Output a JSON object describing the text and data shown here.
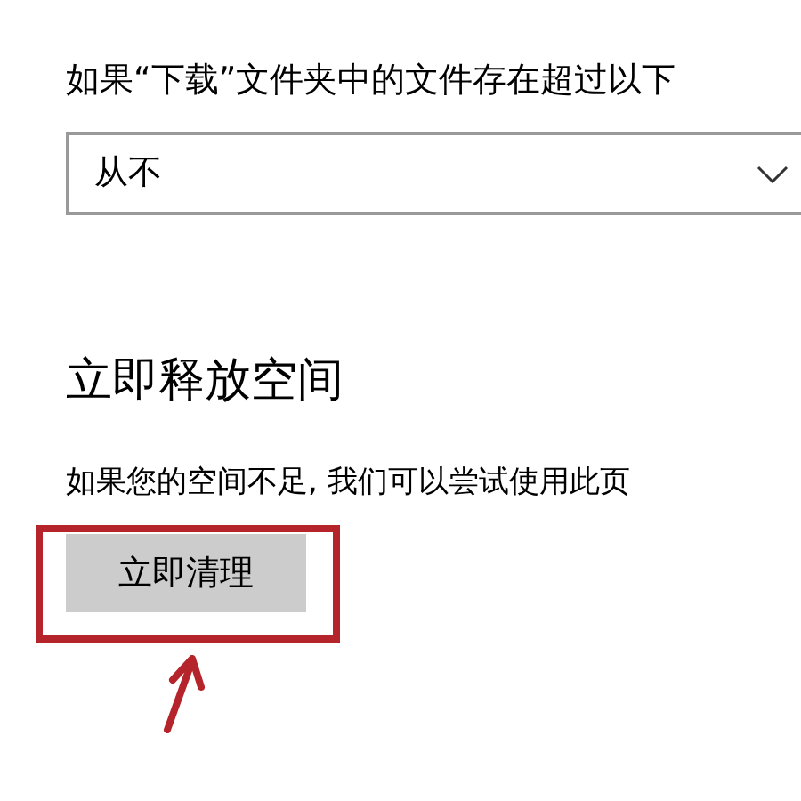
{
  "retention": {
    "label": "如果“下载”文件夹中的文件存在超过以下",
    "dropdown": {
      "value": "从不"
    }
  },
  "free_space": {
    "heading": "立即释放空间",
    "description": "如果您的空间不足, 我们可以尝试使用此页",
    "button": "立即清理"
  },
  "annotation": {
    "kind": "box-and-arrow",
    "color": "#b5242a"
  }
}
